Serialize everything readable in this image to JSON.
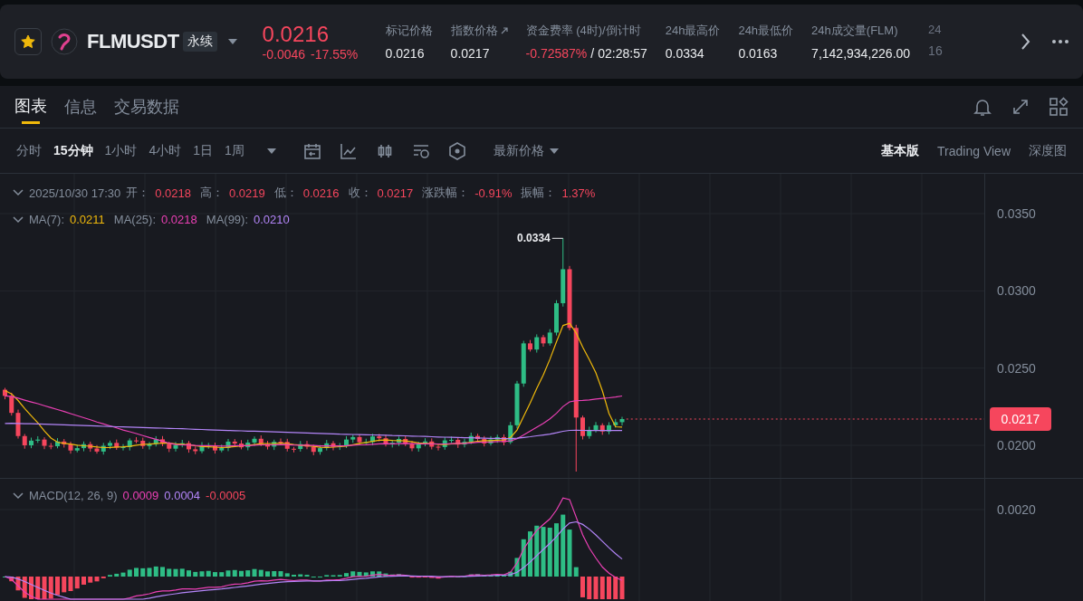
{
  "header": {
    "favorite": true,
    "symbol": "FLMUSDT",
    "contract_type": "永续",
    "last_price": "0.0216",
    "change": "-0.0046",
    "change_percent": "-17.55%",
    "stats": [
      {
        "label": "标记价格",
        "value": "0.0216"
      },
      {
        "label": "指数价格",
        "value": "0.0217",
        "link": true
      },
      {
        "label": "资金费率 (4时)/倒计时",
        "value": "-0.72587%",
        "color": "#f6465d",
        "separator": "/",
        "countdown": "02:28:57"
      },
      {
        "label": "24h最高价",
        "value": "0.0334"
      },
      {
        "label": "24h最低价",
        "value": "0.0163"
      },
      {
        "label": "24h成交量(FLM)",
        "value": "7,142,934,226.00"
      },
      {
        "label": "24",
        "value": "16",
        "faded": true
      }
    ]
  },
  "tabs": [
    {
      "label": "图表",
      "selected": true
    },
    {
      "label": "信息",
      "selected": false
    },
    {
      "label": "交易数据",
      "selected": false
    }
  ],
  "intervals": [
    {
      "label": "分时",
      "selected": false
    },
    {
      "label": "15分钟",
      "selected": true
    },
    {
      "label": "1小时",
      "selected": false
    },
    {
      "label": "4小时",
      "selected": false
    },
    {
      "label": "1日",
      "selected": false
    },
    {
      "label": "1周",
      "selected": false
    }
  ],
  "price_type": "最新价格",
  "views": [
    {
      "label": "基本版",
      "selected": true
    },
    {
      "label": "Trading View",
      "selected": false
    },
    {
      "label": "深度图",
      "selected": false
    }
  ],
  "chart": {
    "ohlc": {
      "datetime": "2025/10/30 17:30",
      "fields": [
        {
          "label": "开：",
          "value": "0.0218"
        },
        {
          "label": "高：",
          "value": "0.0219"
        },
        {
          "label": "低：",
          "value": "0.0216"
        },
        {
          "label": "收：",
          "value": "0.0217"
        },
        {
          "label": "涨跌幅：",
          "value": "-0.91%"
        },
        {
          "label": "振幅：",
          "value": "1.37%"
        }
      ]
    },
    "ma": [
      {
        "label": "MA(7):",
        "value": "0.0211",
        "color": "#f0b90b"
      },
      {
        "label": "MA(25):",
        "value": "0.0218",
        "color": "#eb40b5"
      },
      {
        "label": "MA(99):",
        "value": "0.0210",
        "color": "#b385f8"
      }
    ],
    "y_axis": [
      "0.0350",
      "0.0300",
      "0.0250",
      "0.0200"
    ],
    "high_marker": "0.0334",
    "current_price": "0.0217",
    "macd": {
      "label": "MACD(12, 26, 9)",
      "values": [
        {
          "value": "0.0009",
          "color": "#eb40b5"
        },
        {
          "value": "0.0004",
          "color": "#b385f8"
        },
        {
          "value": "-0.0005",
          "color": "#f6465d"
        }
      ],
      "y_axis": [
        "0.0020"
      ]
    }
  }
}
